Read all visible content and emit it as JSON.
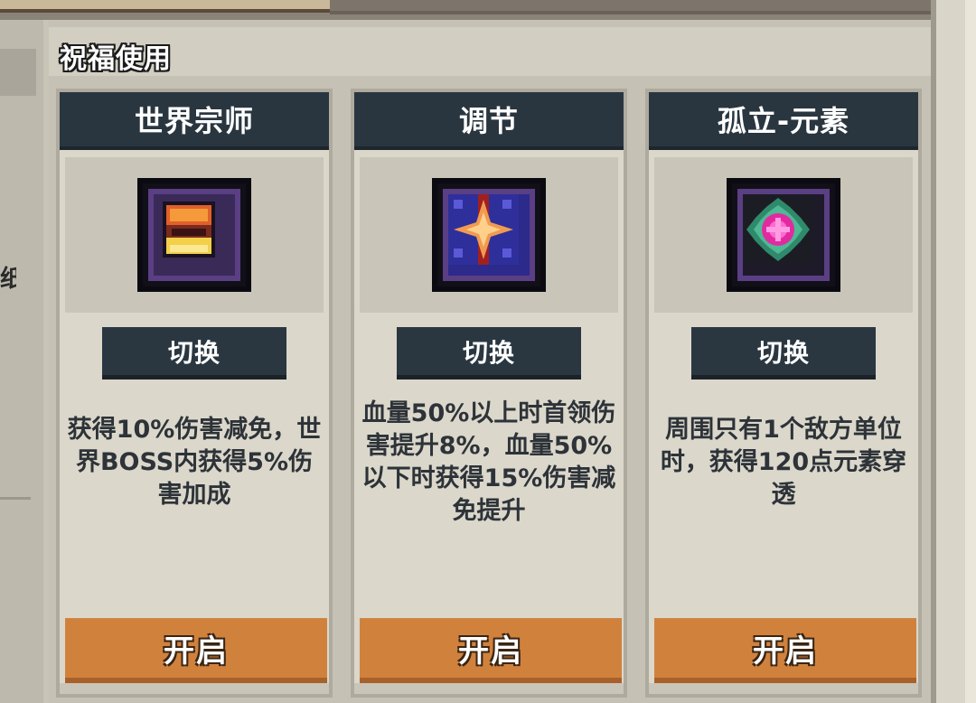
{
  "section": {
    "title": "祝福使用"
  },
  "left_panel": {
    "partial_char": "纸"
  },
  "cards": [
    {
      "title": "世界宗师",
      "icon": "world-master-crown-icon",
      "switch_label": "切换",
      "description": "获得10%伤害减免，世界BOSS内获得5%伤害加成",
      "open_label": "开启"
    },
    {
      "title": "调节",
      "icon": "regulate-star-icon",
      "switch_label": "切换",
      "description": "血量50%以上时首领伤害提升8%，血量50%以下时获得15%伤害减免提升",
      "open_label": "开启"
    },
    {
      "title": "孤立-元素",
      "icon": "isolate-element-gem-icon",
      "switch_label": "切换",
      "description": "周围只有1个敌方单位时，获得120点元素穿透",
      "open_label": "开启"
    }
  ],
  "colors": {
    "header_bg": "#293640",
    "open_button": "#d0823d",
    "switch_button": "#2a3741"
  }
}
